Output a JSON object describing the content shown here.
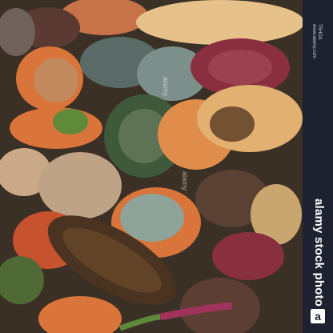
{
  "watermarks": [
    "alamy",
    "alamy"
  ],
  "sidebar": {
    "image_id": "T5HDA",
    "site": "www.alamy.com",
    "brand_text": "alamy stock photo",
    "logo_letter": "a"
  },
  "colors": {
    "sidebar_bg": "#1e2230",
    "beet": "#8a2f3f",
    "carrot": "#d9743a",
    "parsnip": "#e6c28a",
    "mold": "#7d8f8a",
    "greens": "#5f8a3a"
  }
}
